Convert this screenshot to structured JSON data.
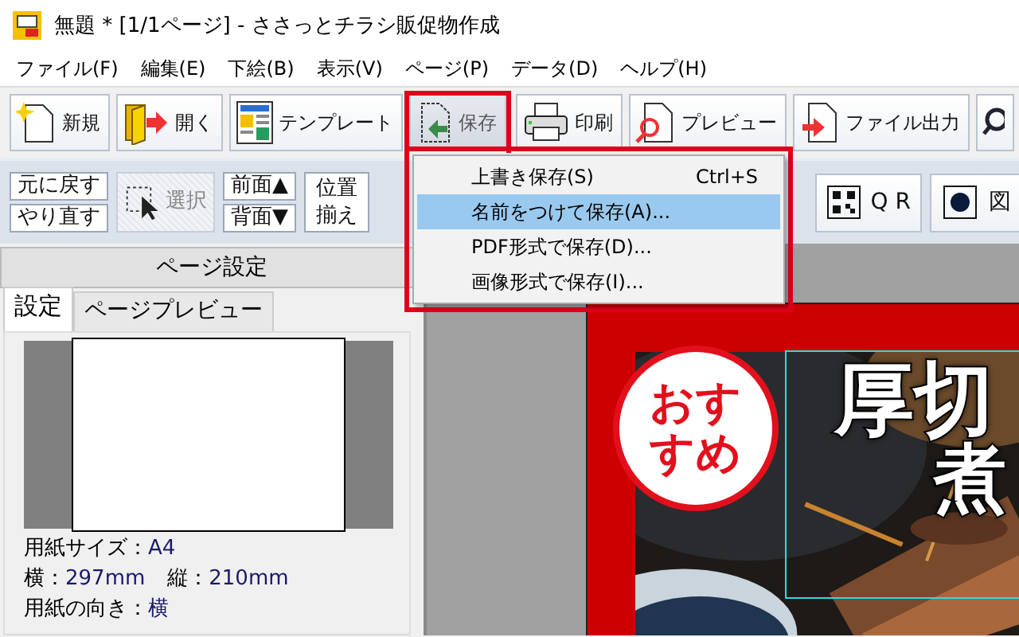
{
  "window": {
    "title": "無題 *  [1/1ページ] - ささっとチラシ販促物作成"
  },
  "menu": [
    "ファイル(F)",
    "編集(E)",
    "下絵(B)",
    "表示(V)",
    "ページ(P)",
    "データ(D)",
    "ヘルプ(H)"
  ],
  "toolbar": [
    {
      "kind": "new",
      "label": "新規",
      "pressed": false
    },
    {
      "kind": "open",
      "label": "開く",
      "pressed": false
    },
    {
      "kind": "template",
      "label": "テンプレート",
      "pressed": false
    },
    {
      "kind": "save",
      "label": "保存",
      "pressed": true
    },
    {
      "kind": "print",
      "label": "印刷",
      "pressed": false
    },
    {
      "kind": "preview",
      "label": "プレビュー",
      "pressed": false
    },
    {
      "kind": "export",
      "label": "ファイル出力",
      "pressed": false
    },
    {
      "kind": "zoom",
      "pressed": false
    }
  ],
  "edit_bar": {
    "undo": "元に戻す",
    "redo": "やり直す",
    "select": {
      "label": "選択",
      "selected": true
    },
    "front": "前面▲",
    "back": "背面▼",
    "align": "位置揃え",
    "qr": "Q R",
    "shape": "図"
  },
  "save_menu": [
    {
      "label": "上書き保存(S)",
      "shortcut": "Ctrl+S",
      "selected": false
    },
    {
      "label": "名前をつけて保存(A)...",
      "selected": true
    },
    {
      "label": "PDF形式で保存(D)...",
      "selected": false
    },
    {
      "label": "画像形式で保存(I)...",
      "selected": false
    }
  ],
  "panel": {
    "title": "ページ設定",
    "tabs": [
      {
        "label": "設定",
        "selected": true
      },
      {
        "label": "ページプレビュー",
        "selected": false
      }
    ],
    "info": [
      [
        {
          "label": "用紙サイズ：",
          "value": "A4"
        }
      ],
      [
        {
          "label": "横：",
          "value": "297mm"
        },
        {
          "label": "縦：",
          "value": "210mm"
        }
      ],
      [
        {
          "label": "用紙の向き：",
          "value": "横"
        }
      ]
    ]
  },
  "flyer": {
    "stamp": "おすすめ",
    "headline": "厚切",
    "subline": "煮"
  }
}
